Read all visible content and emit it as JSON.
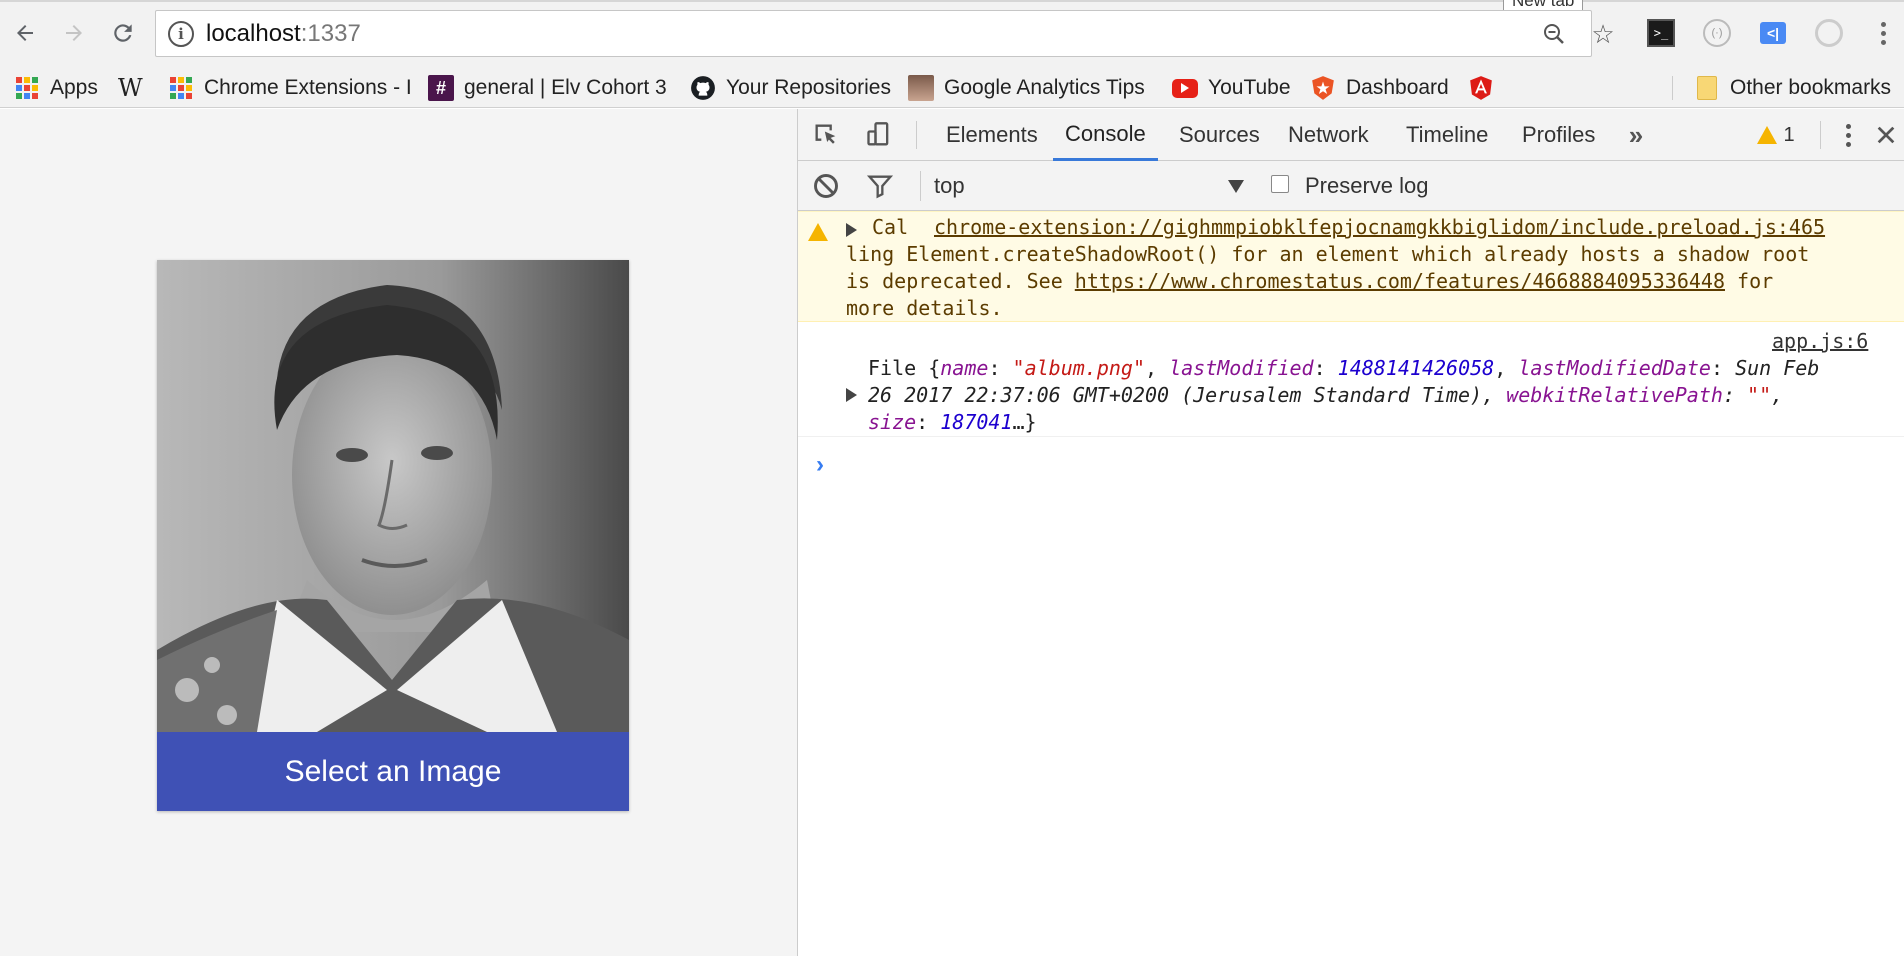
{
  "browser": {
    "new_tab_tooltip": "New tab",
    "url_host": "localhost",
    "url_port": ":1337"
  },
  "bookmarks": [
    {
      "label": "Apps"
    },
    {
      "label": "W"
    },
    {
      "label": "Chrome Extensions - I"
    },
    {
      "label": "general | Elv Cohort 3"
    },
    {
      "label": "Your Repositories"
    },
    {
      "label": "Google Analytics Tips"
    },
    {
      "label": "YouTube"
    },
    {
      "label": "Dashboard"
    },
    {
      "label": "Other bookmarks"
    }
  ],
  "page": {
    "button_label": "Select an Image"
  },
  "devtools": {
    "tabs": [
      "Elements",
      "Console",
      "Sources",
      "Network",
      "Timeline",
      "Profiles"
    ],
    "active_tab": "Console",
    "warning_count": "1",
    "context": "top",
    "preserve_log_label": "Preserve log",
    "preserve_log_checked": false,
    "warning_message": {
      "prefix": "Cal",
      "source": "chrome-extension://gighmmpiobklfepjocnamgkkbiglidom/include.preload.js:465",
      "line2": "ling Element.createShadowRoot() for an element which already hosts a shadow root",
      "line3_pre": "is deprecated. See ",
      "line3_link": "https://www.chromestatus.com/features/4668884095336448",
      "line3_post": " for",
      "line4": "more details."
    },
    "log_message": {
      "source": "app.js:6",
      "object_type": "File",
      "name_key": "name",
      "name_val": "\"album.png\"",
      "lm_key": "lastModified",
      "lm_val": "1488141426058",
      "lmd_key": "lastModifiedDate",
      "lmd_val_1": "Sun Feb",
      "lmd_val_2": "26 2017 22:37:06 GMT+0200 (Jerusalem Standard Time)",
      "wrp_key": "webkitRelativePath",
      "wrp_val": "\"\"",
      "size_key": "size",
      "size_val": "187041"
    }
  },
  "colors": {
    "accent_button": "#3f51b5",
    "devtools_active_tab": "#3879d9",
    "warning_bg": "#fffbe5"
  }
}
